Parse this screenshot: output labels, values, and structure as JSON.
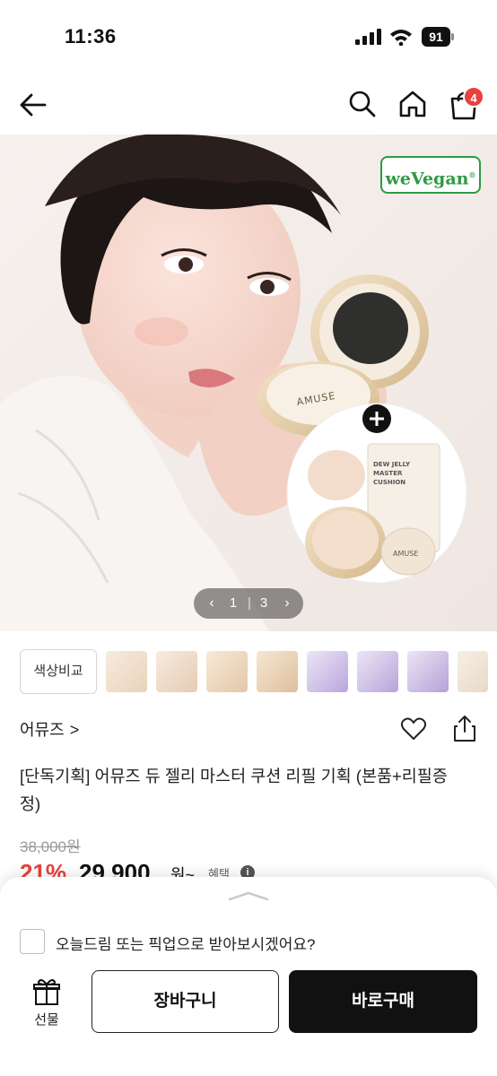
{
  "status_bar": {
    "time": "11:36",
    "battery": "91"
  },
  "nav": {
    "cart_count": "4"
  },
  "hero": {
    "badge": "weVegan",
    "compact_brand": "AMUSE",
    "refill_box_text": "DEW JELLY MASTER CUSHION",
    "pager": {
      "current": "1",
      "separator": "|",
      "total": "3"
    }
  },
  "shades": {
    "compare_label": "색상비교"
  },
  "product": {
    "brand": "어뮤즈",
    "brand_chevron": ">",
    "title": "[단독기획] 어뮤즈 듀 젤리 마스터 쿠션 리필 기획 (본품+리필증정)",
    "original_price": "38,000원",
    "discount": "21%",
    "sale_price": "29,900",
    "sale_suffix": "원~",
    "benefit_label": "혜택",
    "info_glyph": "i"
  },
  "sheet": {
    "pickup_question": "오늘드림 또는 픽업으로 받아보시겠어요?",
    "gift_label": "선물",
    "cart_button": "장바구니",
    "buy_button": "바로구매"
  },
  "colors": {
    "accent_red": "#e8413e",
    "vegan_green": "#2f9a44",
    "dark_button": "#111111"
  }
}
